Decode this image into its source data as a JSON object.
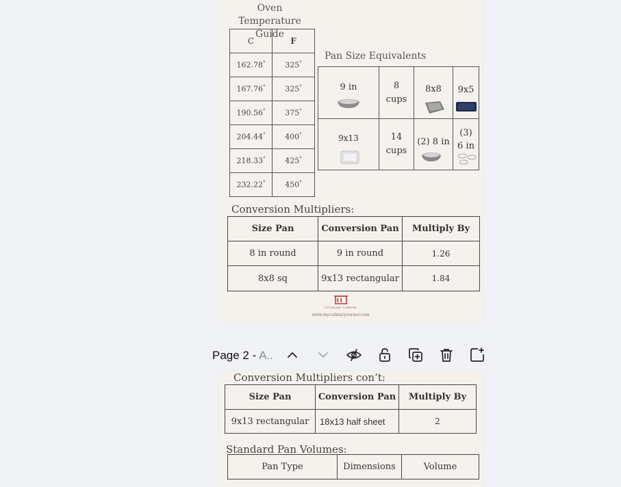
{
  "page1": {
    "oven": {
      "title": "Oven Temperature Guide",
      "headers": [
        "C",
        "F"
      ],
      "rows": [
        [
          "162.78",
          "325"
        ],
        [
          "167.76",
          "325"
        ],
        [
          "190.56",
          "375"
        ],
        [
          "204.44",
          "400"
        ],
        [
          "218.33",
          "425"
        ],
        [
          "232.22",
          "450"
        ]
      ],
      "degree": "°"
    },
    "pans": {
      "title": "Pan Size Equivalents",
      "row1": [
        "9 in",
        "8 cups",
        "8x8",
        "9x5"
      ],
      "row2": [
        "9x13",
        "14 cups",
        "(2) 8 in",
        "(3) 6 in"
      ]
    },
    "conversion": {
      "title": "Conversion Multipliers:",
      "headers": [
        "Size Pan",
        "Conversion Pan",
        "Multiply By"
      ],
      "rows": [
        [
          "8 in round",
          "9 in round",
          "1.26"
        ],
        [
          "8x8 sq",
          "9x13 rectangular",
          "1.84"
        ]
      ]
    },
    "logo_text": "CULINARY CORNER",
    "website": "www.myculinarycorner.com"
  },
  "toolbar": {
    "page_label": "Page 2 -",
    "page_title": "A..",
    "icons": [
      "chevron-up-icon",
      "chevron-down-icon",
      "hide-icon",
      "unlock-icon",
      "duplicate-icon",
      "trash-icon",
      "add-page-icon"
    ]
  },
  "page2": {
    "conversion": {
      "title": "Conversion Multipliers con’t:",
      "headers": [
        "Size Pan",
        "Conversion Pan",
        "Multiply By"
      ],
      "rows": [
        [
          "9x13 rectangular",
          "18x13 half sheet",
          "2"
        ]
      ]
    },
    "volumes": {
      "title": "Standard Pan Volumes:",
      "headers": [
        "Pan Type",
        "Dimensions",
        "Volume"
      ]
    }
  }
}
